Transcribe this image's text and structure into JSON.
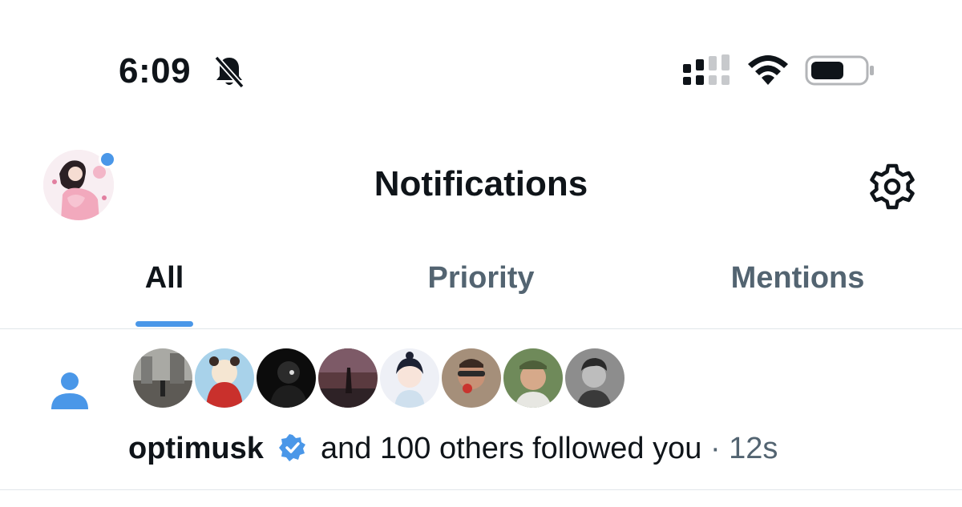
{
  "status_bar": {
    "time": "6:09",
    "icons": [
      "bell-slash-icon",
      "cellular-signal-icon",
      "wifi-icon",
      "battery-icon"
    ]
  },
  "header": {
    "title": "Notifications",
    "icons": [
      "profile-avatar",
      "settings-gear-icon"
    ]
  },
  "tabs": [
    {
      "label": "All",
      "active": true
    },
    {
      "label": "Priority",
      "active": false
    },
    {
      "label": "Mentions",
      "active": false
    }
  ],
  "notification": {
    "type_icon": "person-icon",
    "username": "optimusk",
    "rest": "and 100 others followed you",
    "separator": "·",
    "time": "12s"
  },
  "colors": {
    "accent": "#4a97e8",
    "text_primary": "#0f1419",
    "text_secondary": "#536471",
    "divider": "#e1e6ea"
  }
}
